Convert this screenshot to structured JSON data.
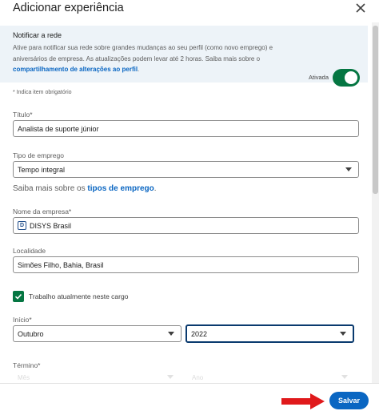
{
  "header": {
    "title": "Adicionar experiência"
  },
  "notify": {
    "title": "Notificar a rede",
    "body": "Ative para notificar sua rede sobre grandes mudanças ao seu perfil (como novo emprego) e aniversários de empresa. As atualizações podem levar até 2 horas. Saiba mais sobre o ",
    "link": "compartilhamento de alterações ao perfil",
    "link_end": ".",
    "state": "Ativada",
    "enabled": true
  },
  "required_note": "* Indica item obrigatório",
  "fields": {
    "title": {
      "label": "Título*",
      "value": "Analista de suporte júnior"
    },
    "employment_type": {
      "label": "Tipo de emprego",
      "value": "Tempo integral"
    },
    "help": {
      "prefix": "Saiba mais sobre os ",
      "link": "tipos de emprego",
      "suffix": "."
    },
    "company": {
      "label": "Nome da empresa*",
      "value": "DISYS Brasil",
      "logo_text": "D"
    },
    "location": {
      "label": "Localidade",
      "value": "Simões Filho, Bahia, Brasil"
    },
    "current": {
      "label": "Trabalho atualmente neste cargo",
      "checked": true
    },
    "start": {
      "label": "Início*",
      "month": "Outubro",
      "year": "2022"
    },
    "end": {
      "label": "Término*",
      "month_placeholder": "Mês",
      "year_placeholder": "Ano"
    }
  },
  "footer": {
    "save_label": "Salvar"
  },
  "colors": {
    "accent": "#0a66c2",
    "toggle_on": "#057642",
    "arrow": "#e0191b"
  }
}
